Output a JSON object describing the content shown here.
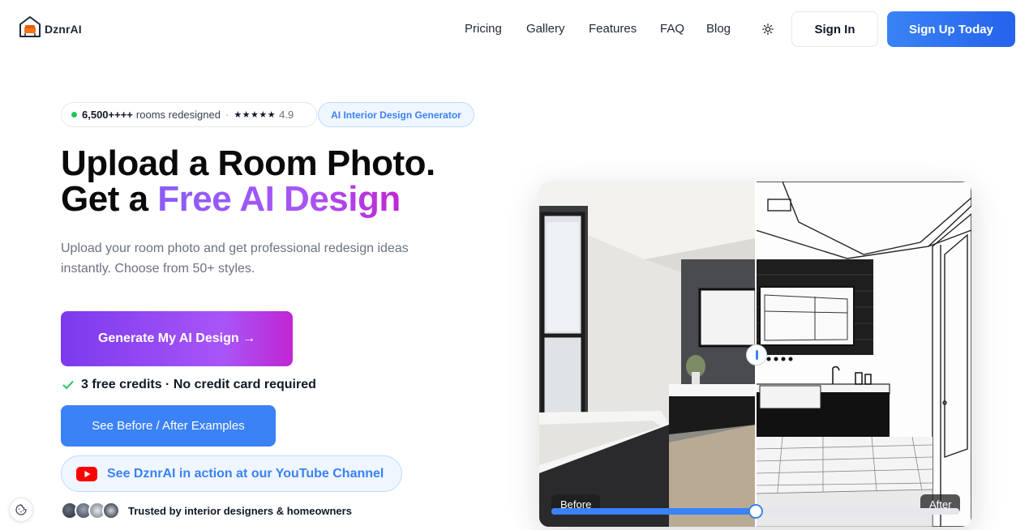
{
  "brand": {
    "name": "DznrAI",
    "logo_icon": "house-chair-icon"
  },
  "nav": {
    "items": [
      "Pricing",
      "Gallery",
      "Features",
      "FAQ",
      "Blog"
    ]
  },
  "header": {
    "theme_icon": "sun-icon",
    "signin_label": "Sign In",
    "signup_label": "Sign Up Today"
  },
  "badge": {
    "count": "6,500++++",
    "text": "rooms redesigned",
    "separator": "·",
    "stars": "★★★★★",
    "score": "4.9",
    "tag": "AI Interior Design Generator"
  },
  "hero": {
    "line1": "Upload a Room Photo.",
    "line2_prefix": "Get a ",
    "line2_highlight": "Free AI Design",
    "subtext": "Upload your room photo and get professional redesign ideas instantly. Choose from 50+ styles."
  },
  "cta": {
    "generate_label": "Generate My AI Design →",
    "credits_text": "3 free credits · No credit card required",
    "examples_label": "See Before / After Examples",
    "youtube_label": "See DznrAI in action at our YouTube Channel"
  },
  "trusted": {
    "text": "Trusted by interior designers & homeowners"
  },
  "compare": {
    "before_label": "Before",
    "after_label": "After",
    "position": 0.5
  },
  "colors": {
    "primary_blue": "#3b82f6",
    "purple_start": "#7c3aed",
    "purple_end": "#c026d3",
    "green_dot": "#22c55e"
  }
}
